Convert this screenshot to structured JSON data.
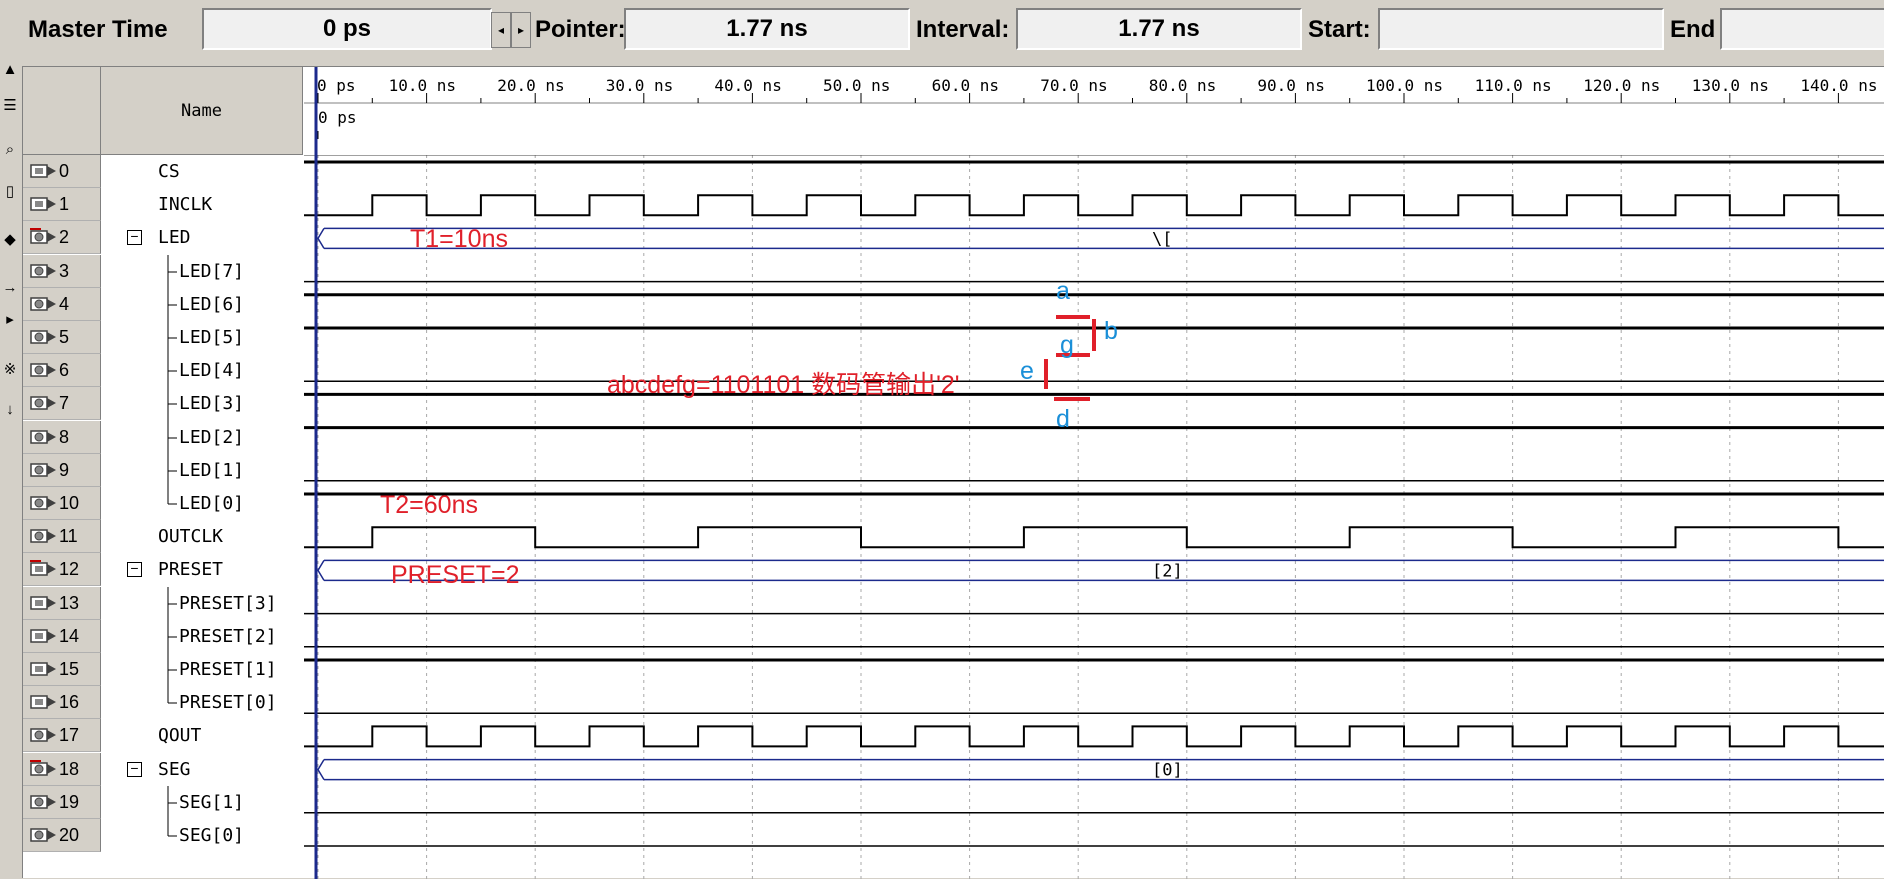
{
  "toolbar": {
    "master_time_label": "Master Time",
    "master_time_value": "0 ps",
    "pointer_label": "Pointer:",
    "pointer_value": "1.77 ns",
    "interval_label": "Interval:",
    "interval_value": "1.77 ns",
    "start_label": "Start:",
    "start_value": "",
    "end_label": "End",
    "end_value": ""
  },
  "panel": {
    "name_header": "Name"
  },
  "time_ruler": {
    "ticks": [
      "0 ps",
      "10.0 ns",
      "20.0 ns",
      "30.0 ns",
      "40.0 ns",
      "50.0 ns",
      "60.0 ns",
      "70.0 ns",
      "80.0 ns",
      "90.0 ns",
      "100.0 ns",
      "110.0 ns",
      "120.0 ns",
      "130.0 ns",
      "140.0 ns"
    ],
    "cursor_label": "0 ps"
  },
  "signals": [
    {
      "id": "0",
      "name": "CS",
      "kind": "in",
      "level": 1
    },
    {
      "id": "1",
      "name": "INCLK",
      "kind": "in",
      "clock": "inclk"
    },
    {
      "id": "2",
      "name": "LED",
      "kind": "bus_out",
      "group": true,
      "value": "\\["
    },
    {
      "id": "3",
      "name": "LED[7]",
      "kind": "out",
      "child": true,
      "level": 0
    },
    {
      "id": "4",
      "name": "LED[6]",
      "kind": "out",
      "child": true,
      "level": 1
    },
    {
      "id": "5",
      "name": "LED[5]",
      "kind": "out",
      "child": true,
      "level": 1
    },
    {
      "id": "6",
      "name": "LED[4]",
      "kind": "out",
      "child": true,
      "level": 0
    },
    {
      "id": "7",
      "name": "LED[3]",
      "kind": "out",
      "child": true,
      "level": 1
    },
    {
      "id": "8",
      "name": "LED[2]",
      "kind": "out",
      "child": true,
      "level": 1
    },
    {
      "id": "9",
      "name": "LED[1]",
      "kind": "out",
      "child": true,
      "level": 0
    },
    {
      "id": "10",
      "name": "LED[0]",
      "kind": "out",
      "child": true,
      "last": true,
      "level": 1
    },
    {
      "id": "11",
      "name": "OUTCLK",
      "kind": "out",
      "clock": "outclk"
    },
    {
      "id": "12",
      "name": "PRESET",
      "kind": "bus_in",
      "group": true,
      "value": "[2]"
    },
    {
      "id": "13",
      "name": "PRESET[3]",
      "kind": "in",
      "child": true,
      "level": 0
    },
    {
      "id": "14",
      "name": "PRESET[2]",
      "kind": "in",
      "child": true,
      "level": 0
    },
    {
      "id": "15",
      "name": "PRESET[1]",
      "kind": "in",
      "child": true,
      "level": 1
    },
    {
      "id": "16",
      "name": "PRESET[0]",
      "kind": "in",
      "child": true,
      "last": true,
      "level": 0
    },
    {
      "id": "17",
      "name": "QOUT",
      "kind": "out",
      "clock": "inclk"
    },
    {
      "id": "18",
      "name": "SEG",
      "kind": "bus_out",
      "group": true,
      "value": "[0]"
    },
    {
      "id": "19",
      "name": "SEG[1]",
      "kind": "out",
      "child": true,
      "level": 0
    },
    {
      "id": "20",
      "name": "SEG[0]",
      "kind": "out",
      "child": true,
      "last": true,
      "level": 0
    }
  ],
  "annotations": {
    "t1": "T1=10ns",
    "t2": "T2=60ns",
    "preset": "PRESET=2",
    "segment": "abcdefg=1101101 数码管输出'2'",
    "seg_a": "a",
    "seg_b": "b",
    "seg_g": "g",
    "seg_e": "e",
    "seg_d": "d"
  },
  "colors": {
    "annotation_red": "#e0202a",
    "annotation_blue": "#1a8fd8",
    "bus_line": "#1c2a8c",
    "grid": "#a8a8a8"
  }
}
